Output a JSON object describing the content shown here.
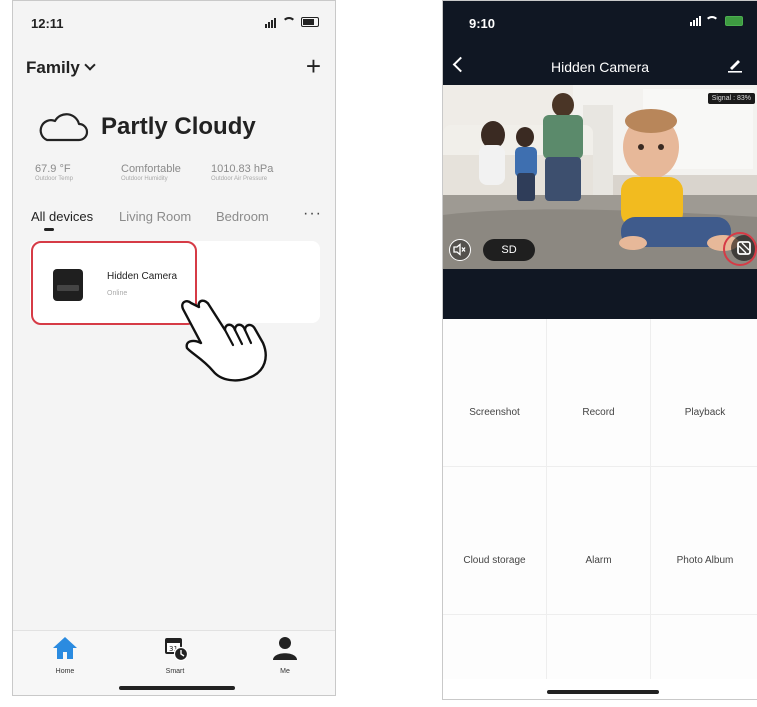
{
  "left_screen": {
    "status": {
      "time": "12:11"
    },
    "header": {
      "home_name": "Family",
      "add_label": "+"
    },
    "weather": {
      "condition": "Partly Cloudy",
      "stats": [
        {
          "value": "67.9 °F",
          "label": "Outdoor Temp"
        },
        {
          "value": "Comfortable",
          "label": "Outdoor Humidity"
        },
        {
          "value": "1010.83 hPa",
          "label": "Outdoor Air Pressure"
        }
      ]
    },
    "room_tabs": [
      "All devices",
      "Living Room",
      "Bedroom"
    ],
    "more_label": "···",
    "device": {
      "name": "Hidden Camera",
      "status": "Online"
    },
    "tabbar": [
      {
        "label": "Home",
        "icon": "home-icon"
      },
      {
        "label": "Smart",
        "icon": "smart-icon"
      },
      {
        "label": "Me",
        "icon": "user-icon"
      }
    ],
    "colors": {
      "accent": "#2b8be0",
      "highlight": "#d63b46"
    }
  },
  "right_screen": {
    "status": {
      "time": "9:10"
    },
    "nav": {
      "title": "Hidden Camera"
    },
    "video": {
      "signal": "Signal : 83%",
      "quality": "SD"
    },
    "actions": [
      {
        "label": "Screenshot",
        "icon": "camera-icon"
      },
      {
        "label": "Record",
        "icon": "video-record-icon"
      },
      {
        "label": "Playback",
        "icon": "playback-icon"
      },
      {
        "label": "Cloud storage",
        "icon": "cloud-storage-icon"
      },
      {
        "label": "Alarm",
        "icon": "alarm-icon"
      },
      {
        "label": "Photo Album",
        "icon": "photo-album-icon"
      }
    ],
    "colors": {
      "header_bg": "#101723"
    }
  }
}
